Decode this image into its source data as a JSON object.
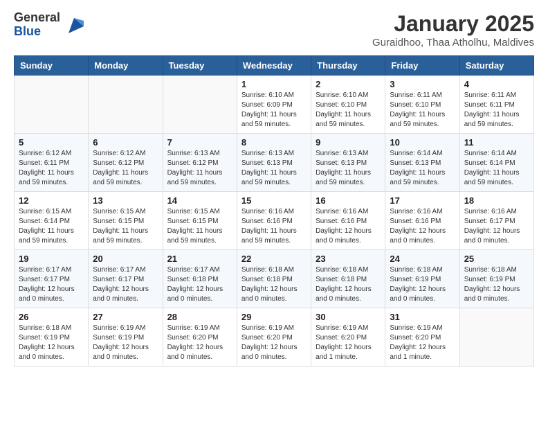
{
  "logo": {
    "general": "General",
    "blue": "Blue"
  },
  "header": {
    "title": "January 2025",
    "subtitle": "Guraidhoo, Thaa Atholhu, Maldives"
  },
  "weekdays": [
    "Sunday",
    "Monday",
    "Tuesday",
    "Wednesday",
    "Thursday",
    "Friday",
    "Saturday"
  ],
  "weeks": [
    [
      {
        "day": "",
        "info": ""
      },
      {
        "day": "",
        "info": ""
      },
      {
        "day": "",
        "info": ""
      },
      {
        "day": "1",
        "info": "Sunrise: 6:10 AM\nSunset: 6:09 PM\nDaylight: 11 hours\nand 59 minutes."
      },
      {
        "day": "2",
        "info": "Sunrise: 6:10 AM\nSunset: 6:10 PM\nDaylight: 11 hours\nand 59 minutes."
      },
      {
        "day": "3",
        "info": "Sunrise: 6:11 AM\nSunset: 6:10 PM\nDaylight: 11 hours\nand 59 minutes."
      },
      {
        "day": "4",
        "info": "Sunrise: 6:11 AM\nSunset: 6:11 PM\nDaylight: 11 hours\nand 59 minutes."
      }
    ],
    [
      {
        "day": "5",
        "info": "Sunrise: 6:12 AM\nSunset: 6:11 PM\nDaylight: 11 hours\nand 59 minutes."
      },
      {
        "day": "6",
        "info": "Sunrise: 6:12 AM\nSunset: 6:12 PM\nDaylight: 11 hours\nand 59 minutes."
      },
      {
        "day": "7",
        "info": "Sunrise: 6:13 AM\nSunset: 6:12 PM\nDaylight: 11 hours\nand 59 minutes."
      },
      {
        "day": "8",
        "info": "Sunrise: 6:13 AM\nSunset: 6:13 PM\nDaylight: 11 hours\nand 59 minutes."
      },
      {
        "day": "9",
        "info": "Sunrise: 6:13 AM\nSunset: 6:13 PM\nDaylight: 11 hours\nand 59 minutes."
      },
      {
        "day": "10",
        "info": "Sunrise: 6:14 AM\nSunset: 6:13 PM\nDaylight: 11 hours\nand 59 minutes."
      },
      {
        "day": "11",
        "info": "Sunrise: 6:14 AM\nSunset: 6:14 PM\nDaylight: 11 hours\nand 59 minutes."
      }
    ],
    [
      {
        "day": "12",
        "info": "Sunrise: 6:15 AM\nSunset: 6:14 PM\nDaylight: 11 hours\nand 59 minutes."
      },
      {
        "day": "13",
        "info": "Sunrise: 6:15 AM\nSunset: 6:15 PM\nDaylight: 11 hours\nand 59 minutes."
      },
      {
        "day": "14",
        "info": "Sunrise: 6:15 AM\nSunset: 6:15 PM\nDaylight: 11 hours\nand 59 minutes."
      },
      {
        "day": "15",
        "info": "Sunrise: 6:16 AM\nSunset: 6:16 PM\nDaylight: 11 hours\nand 59 minutes."
      },
      {
        "day": "16",
        "info": "Sunrise: 6:16 AM\nSunset: 6:16 PM\nDaylight: 12 hours\nand 0 minutes."
      },
      {
        "day": "17",
        "info": "Sunrise: 6:16 AM\nSunset: 6:16 PM\nDaylight: 12 hours\nand 0 minutes."
      },
      {
        "day": "18",
        "info": "Sunrise: 6:16 AM\nSunset: 6:17 PM\nDaylight: 12 hours\nand 0 minutes."
      }
    ],
    [
      {
        "day": "19",
        "info": "Sunrise: 6:17 AM\nSunset: 6:17 PM\nDaylight: 12 hours\nand 0 minutes."
      },
      {
        "day": "20",
        "info": "Sunrise: 6:17 AM\nSunset: 6:17 PM\nDaylight: 12 hours\nand 0 minutes."
      },
      {
        "day": "21",
        "info": "Sunrise: 6:17 AM\nSunset: 6:18 PM\nDaylight: 12 hours\nand 0 minutes."
      },
      {
        "day": "22",
        "info": "Sunrise: 6:18 AM\nSunset: 6:18 PM\nDaylight: 12 hours\nand 0 minutes."
      },
      {
        "day": "23",
        "info": "Sunrise: 6:18 AM\nSunset: 6:18 PM\nDaylight: 12 hours\nand 0 minutes."
      },
      {
        "day": "24",
        "info": "Sunrise: 6:18 AM\nSunset: 6:19 PM\nDaylight: 12 hours\nand 0 minutes."
      },
      {
        "day": "25",
        "info": "Sunrise: 6:18 AM\nSunset: 6:19 PM\nDaylight: 12 hours\nand 0 minutes."
      }
    ],
    [
      {
        "day": "26",
        "info": "Sunrise: 6:18 AM\nSunset: 6:19 PM\nDaylight: 12 hours\nand 0 minutes."
      },
      {
        "day": "27",
        "info": "Sunrise: 6:19 AM\nSunset: 6:19 PM\nDaylight: 12 hours\nand 0 minutes."
      },
      {
        "day": "28",
        "info": "Sunrise: 6:19 AM\nSunset: 6:20 PM\nDaylight: 12 hours\nand 0 minutes."
      },
      {
        "day": "29",
        "info": "Sunrise: 6:19 AM\nSunset: 6:20 PM\nDaylight: 12 hours\nand 0 minutes."
      },
      {
        "day": "30",
        "info": "Sunrise: 6:19 AM\nSunset: 6:20 PM\nDaylight: 12 hours\nand 1 minute."
      },
      {
        "day": "31",
        "info": "Sunrise: 6:19 AM\nSunset: 6:20 PM\nDaylight: 12 hours\nand 1 minute."
      },
      {
        "day": "",
        "info": ""
      }
    ]
  ]
}
